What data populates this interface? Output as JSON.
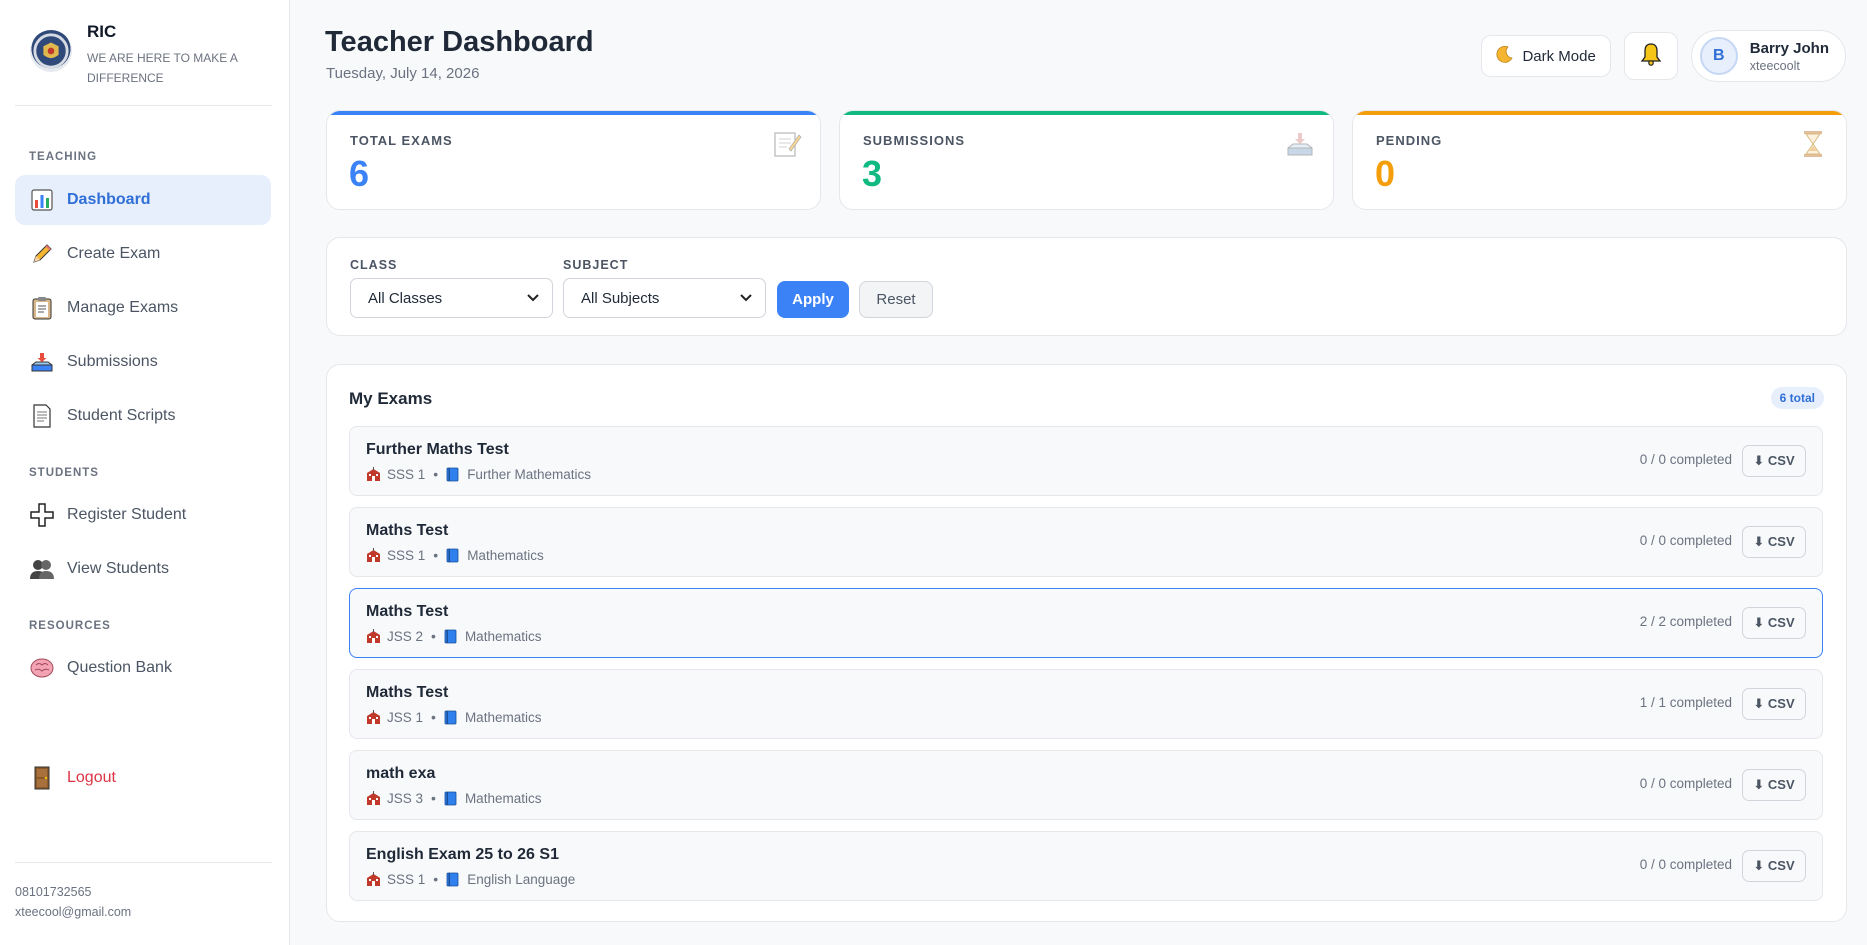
{
  "brand": {
    "name": "RIC",
    "tagline": "WE ARE HERE TO MAKE A DIFFERENCE"
  },
  "sidebar": {
    "sections": [
      {
        "title": "TEACHING",
        "items": [
          {
            "label": "Dashboard",
            "icon": "bar-chart-icon",
            "active": true
          },
          {
            "label": "Create Exam",
            "icon": "pencil-icon"
          },
          {
            "label": "Manage Exams",
            "icon": "clipboard-icon"
          },
          {
            "label": "Submissions",
            "icon": "inbox-tray-icon"
          },
          {
            "label": "Student Scripts",
            "icon": "page-icon"
          }
        ]
      },
      {
        "title": "STUDENTS",
        "items": [
          {
            "label": "Register Student",
            "icon": "plus-icon"
          },
          {
            "label": "View Students",
            "icon": "people-icon"
          }
        ]
      },
      {
        "title": "RESOURCES",
        "items": [
          {
            "label": "Question Bank",
            "icon": "brain-icon"
          }
        ]
      }
    ],
    "logout": {
      "label": "Logout",
      "icon": "door-icon"
    },
    "footer": {
      "phone": "08101732565",
      "email": "xteecool@gmail.com"
    }
  },
  "header": {
    "title": "Teacher Dashboard",
    "date": "Tuesday, July 14, 2026",
    "dark_mode_label": "Dark Mode",
    "user": {
      "initial": "B",
      "name": "Barry John",
      "handle": "xteecoolt"
    }
  },
  "stats": [
    {
      "label": "TOTAL EXAMS",
      "value": "6",
      "color": "#3b82f6",
      "icon": "memo-icon"
    },
    {
      "label": "SUBMISSIONS",
      "value": "3",
      "color": "#10b981",
      "icon": "inbox-tray-icon"
    },
    {
      "label": "PENDING",
      "value": "0",
      "color": "#f59e0b",
      "icon": "hourglass-icon"
    }
  ],
  "filters": {
    "class_label": "CLASS",
    "class_value": "All Classes",
    "subject_label": "SUBJECT",
    "subject_value": "All Subjects",
    "apply_label": "Apply",
    "reset_label": "Reset"
  },
  "exams": {
    "title": "My Exams",
    "badge": "6 total",
    "csv_label": "⬇ CSV",
    "rows": [
      {
        "name": "Further Maths Test",
        "class": "SSS 1",
        "subject": "Further Mathematics",
        "progress": "0 / 0 completed",
        "selected": false
      },
      {
        "name": "Maths Test",
        "class": "SSS 1",
        "subject": "Mathematics",
        "progress": "0 / 0 completed",
        "selected": false
      },
      {
        "name": "Maths Test",
        "class": "JSS 2",
        "subject": "Mathematics",
        "progress": "2 / 2 completed",
        "selected": true
      },
      {
        "name": "Maths Test",
        "class": "JSS 1",
        "subject": "Mathematics",
        "progress": "1 / 1 completed",
        "selected": false
      },
      {
        "name": "math exa",
        "class": "JSS 3",
        "subject": "Mathematics",
        "progress": "0 / 0 completed",
        "selected": false
      },
      {
        "name": "English Exam 25 to 26 S1",
        "class": "SSS 1",
        "subject": "English Language",
        "progress": "0 / 0 completed",
        "selected": false
      }
    ]
  },
  "colors": {
    "accent": "#3b82f6",
    "success": "#10b981",
    "warning": "#f59e0b",
    "danger": "#dc3545"
  }
}
